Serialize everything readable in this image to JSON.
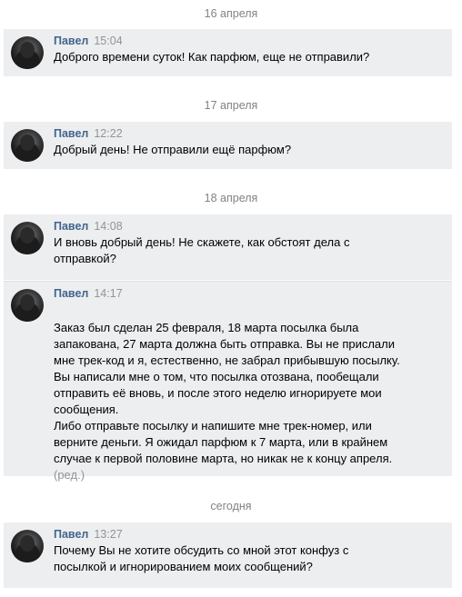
{
  "groups": [
    {
      "date": "16 апреля",
      "messages": [
        {
          "author": "Павел",
          "time": "15:04",
          "text": "Доброго времени суток! Как парфюм, еще не отправили?"
        }
      ]
    },
    {
      "date": "17 апреля",
      "messages": [
        {
          "author": "Павел",
          "time": "12:22",
          "text": "Добрый день! Не отправили ещё парфюм?"
        }
      ]
    },
    {
      "date": "18 апреля",
      "messages": [
        {
          "author": "Павел",
          "time": "14:08",
          "text": "И вновь добрый день! Не скажете, как обстоят дела с\nотправкой?"
        },
        {
          "author": "Павел",
          "time": "14:17",
          "text": "Заказ был сделан 25 февраля, 18 марта посылка была\nзапакована, 27 марта должна быть отправка. Вы не прислали\nмне трек-код и я, естественно, не забрал прибывшую посылку.\nВы написали мне о том, что посылка отозвана, пообещали\nотправить её вновь, и после этого неделю игнорируете мои\nсообщения.\nЛибо отправьте посылку и напишите мне трек-номер, или\nверните деньги. Я ожидал парфюм к 7 марта, или в крайнем\nслучае к первой половине марта, но никак не к концу апреля.",
          "edited": "(ред.)"
        }
      ]
    },
    {
      "date": "сегодня",
      "messages": [
        {
          "author": "Павел",
          "time": "13:27",
          "text": "Почему Вы не хотите обсудить со мной этот конфуз с\nпосылкой и игнорированием моих сообщений?"
        }
      ]
    }
  ]
}
